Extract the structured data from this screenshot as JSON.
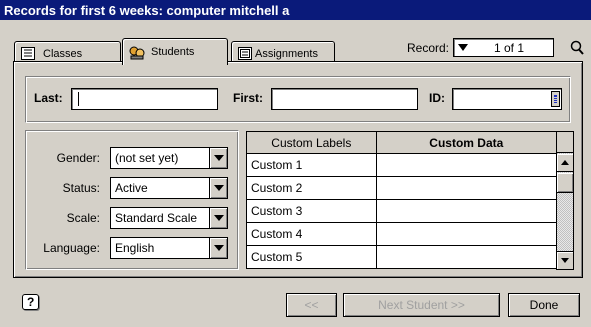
{
  "window": {
    "title": "Records for first 6 weeks: computer mitchell a"
  },
  "tabs": [
    {
      "label": "Classes",
      "icon": "classes-icon"
    },
    {
      "label": "Students",
      "icon": "students-icon",
      "active": true
    },
    {
      "label": "Assignments",
      "icon": "assignments-icon"
    }
  ],
  "record": {
    "label": "Record:",
    "value": "1 of 1"
  },
  "name_fields": {
    "last_label": "Last:",
    "last_value": "",
    "first_label": "First:",
    "first_value": "",
    "id_label": "ID:",
    "id_value": ""
  },
  "attributes": [
    {
      "label": "Gender:",
      "value": "(not set yet)"
    },
    {
      "label": "Status:",
      "value": "Active"
    },
    {
      "label": "Scale:",
      "value": "Standard Scale"
    },
    {
      "label": "Language:",
      "value": "English"
    }
  ],
  "custom_table": {
    "headers": [
      "Custom Labels",
      "Custom Data"
    ],
    "rows": [
      {
        "label": "Custom 1",
        "data": ""
      },
      {
        "label": "Custom 2",
        "data": ""
      },
      {
        "label": "Custom 3",
        "data": ""
      },
      {
        "label": "Custom 4",
        "data": ""
      },
      {
        "label": "Custom 5",
        "data": ""
      }
    ]
  },
  "footer": {
    "help_label": "?",
    "prev_label": "<<",
    "next_label": "Next Student >>",
    "done_label": "Done"
  },
  "colors": {
    "titlebar": "#0a1a7a",
    "face": "#d4d0c8"
  }
}
